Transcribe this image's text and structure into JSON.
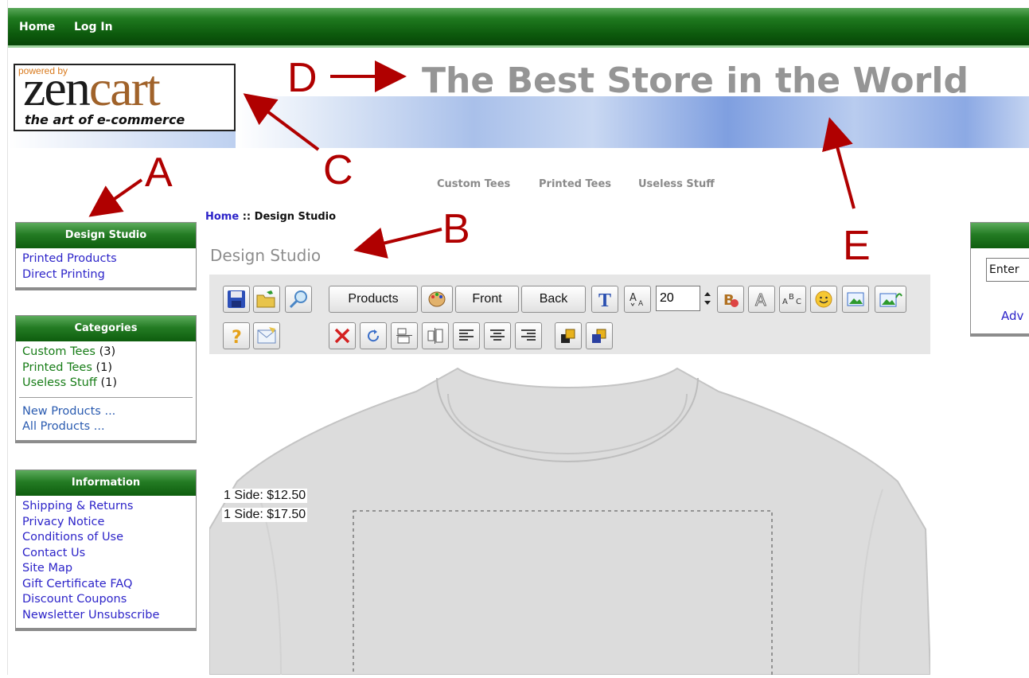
{
  "topnav": {
    "home": "Home",
    "login": "Log In"
  },
  "logo": {
    "powered_by": "powered by",
    "zen": "zen",
    "cart": "cart",
    "tagline": "the art of e-commerce"
  },
  "header": {
    "store_title": "The Best Store in the World"
  },
  "category_nav": [
    "Custom Tees",
    "Printed Tees",
    "Useless Stuff"
  ],
  "sideboxes": {
    "design_studio": {
      "title": "Design Studio",
      "links": [
        "Printed Products",
        "Direct Printing"
      ]
    },
    "categories": {
      "title": "Categories",
      "items": [
        {
          "name": "Custom Tees",
          "count": "(3)"
        },
        {
          "name": "Printed Tees",
          "count": "(1)"
        },
        {
          "name": "Useless Stuff",
          "count": "(1)"
        }
      ],
      "extra": [
        "New Products ...",
        "All Products ..."
      ]
    },
    "information": {
      "title": "Information",
      "links": [
        "Shipping & Returns",
        "Privacy Notice",
        "Conditions of Use",
        "Contact Us",
        "Site Map",
        "Gift Certificate FAQ",
        "Discount Coupons",
        "Newsletter Unsubscribe"
      ]
    }
  },
  "search_box": {
    "input_text": "Enter",
    "advanced_partial": "Adv"
  },
  "breadcrumb": {
    "home": "Home",
    "separator": "::",
    "current": "Design Studio"
  },
  "page": {
    "heading": "Design Studio"
  },
  "toolbar": {
    "products_label": "Products",
    "front_label": "Front",
    "back_label": "Back",
    "font_size": "20",
    "icons": [
      "save-icon",
      "open-folder-icon",
      "zoom-icon",
      "palette-icon",
      "text-icon",
      "font-size-icon",
      "text-color-icon",
      "outline-text-icon",
      "arc-text-icon",
      "smiley-icon",
      "image-icon",
      "upload-image-icon",
      "help-icon",
      "email-icon",
      "delete-icon",
      "rotate-icon",
      "align-vertical-icon",
      "align-horizontal-icon",
      "align-left-icon",
      "align-center-icon",
      "align-right-icon",
      "bring-forward-icon",
      "send-backward-icon"
    ]
  },
  "prices": [
    "1 Side: $12.50",
    "1 Side: $17.50"
  ],
  "annotations": [
    "A",
    "B",
    "C",
    "D",
    "E"
  ],
  "colors": {
    "nav_green": "#0d5a0d",
    "header_text": "#959595",
    "link_blue": "#2d24c9",
    "link_green": "#167c16",
    "annotation_red": "#b00000"
  }
}
